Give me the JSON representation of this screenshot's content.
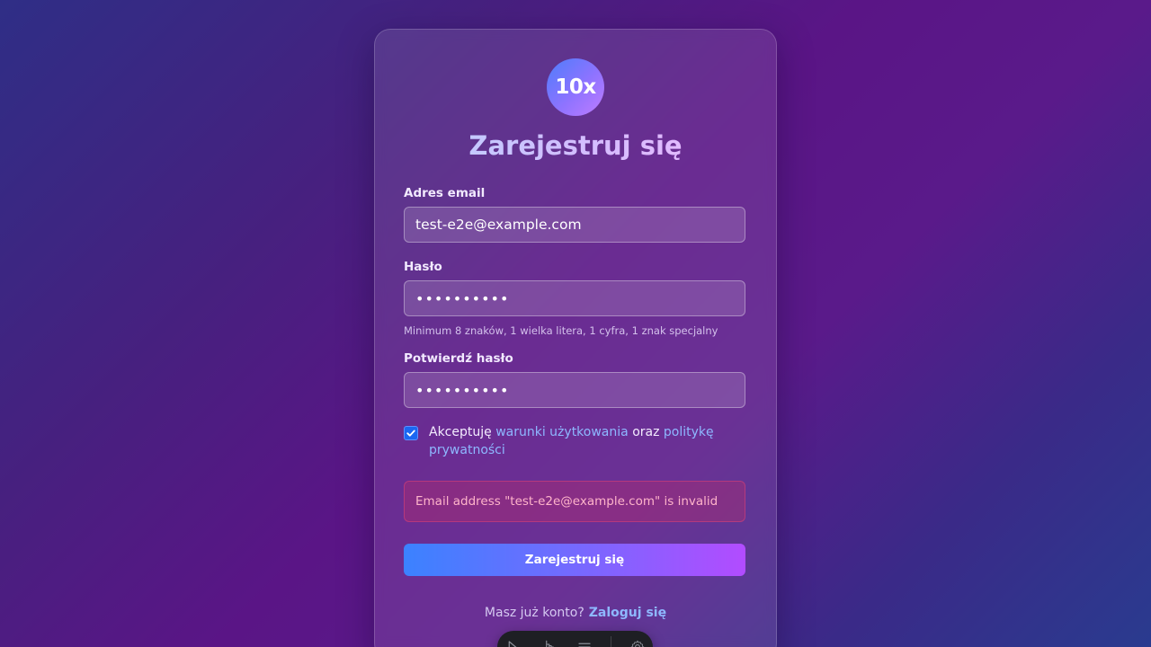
{
  "brand": {
    "logo_text": "10x"
  },
  "page": {
    "title": "Zarejestruj się"
  },
  "form": {
    "email": {
      "label": "Adres email",
      "value": "test-e2e@example.com"
    },
    "password": {
      "label": "Hasło",
      "masked_value": "••••••••••",
      "hint": "Minimum 8 znaków, 1 wielka litera, 1 cyfra, 1 znak specjalny"
    },
    "confirm_password": {
      "label": "Potwierdź hasło",
      "masked_value": "••••••••••"
    },
    "terms": {
      "checked": true,
      "prefix": "Akceptuję",
      "terms_link": "warunki użytkowania",
      "middle": "oraz",
      "privacy_link": "politykę prywatności"
    },
    "error_message": "Email address \"test-e2e@example.com\" is invalid",
    "submit_label": "Zarejestruj się"
  },
  "footer": {
    "prompt": "Masz już konto?",
    "login_link": "Zaloguj się"
  },
  "colors": {
    "accent": "#8eb8ff",
    "button_start": "#3b82ff",
    "button_end": "#b24cff",
    "error_text": "#ffb4ca",
    "error_bg": "#c82c64"
  },
  "dock": {
    "icons": [
      "cursor-icon",
      "pointer-icon",
      "menu-icon",
      "settings-icon"
    ]
  }
}
